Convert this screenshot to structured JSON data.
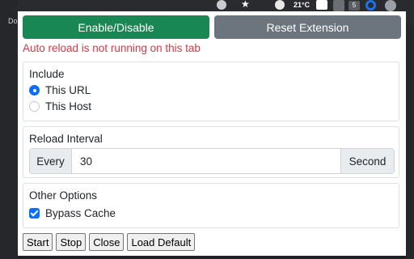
{
  "chrome": {
    "left_text": "Do",
    "tray": {
      "temperature": "21°C",
      "badge_count": "5"
    }
  },
  "popup": {
    "enable_button": "Enable/Disable",
    "reset_button": "Reset Extension",
    "warning": "Auto reload is not running on this tab",
    "include": {
      "title": "Include",
      "options": [
        {
          "label": "This URL",
          "checked": true
        },
        {
          "label": "This Host",
          "checked": false
        }
      ]
    },
    "interval": {
      "title": "Reload Interval",
      "prefix": "Every",
      "value": "30",
      "suffix": "Second"
    },
    "options": {
      "title": "Other Options",
      "bypass_cache": {
        "label": "Bypass Cache",
        "checked": true
      }
    },
    "actions": {
      "start": "Start",
      "stop": "Stop",
      "close": "Close",
      "load_default": "Load Default"
    }
  },
  "colors": {
    "enable": "#198754",
    "reset": "#6c757d",
    "warning": "#dc3545",
    "accent": "#0d6efd"
  }
}
